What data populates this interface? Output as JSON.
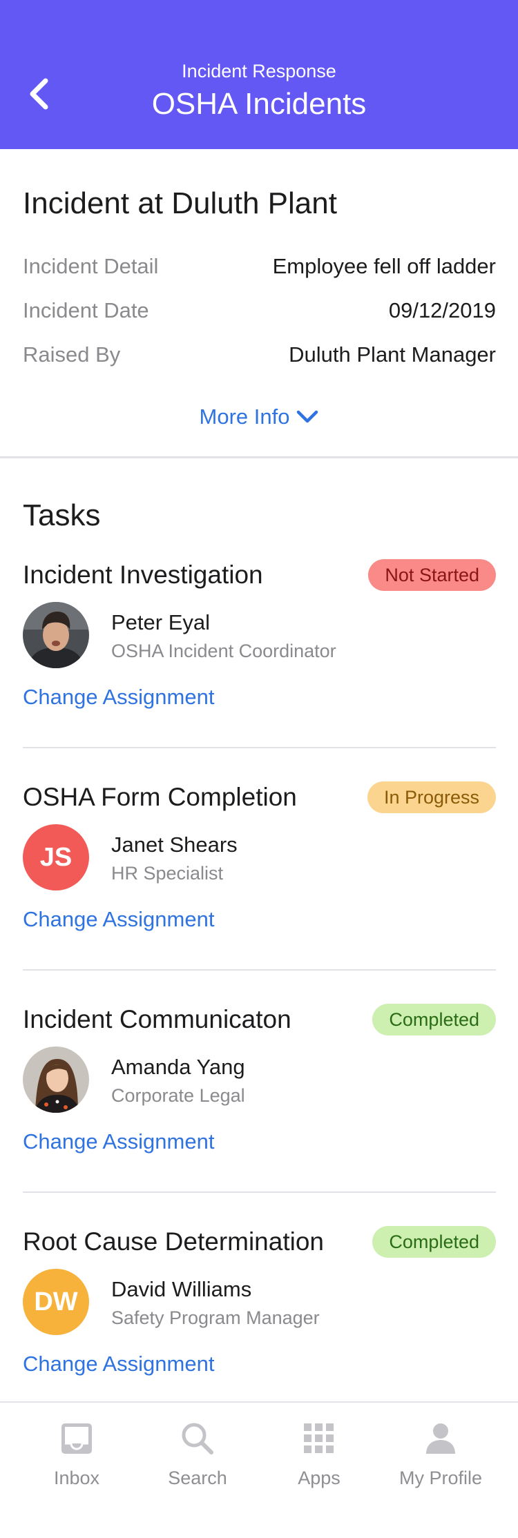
{
  "header": {
    "subtitle": "Incident Response",
    "title": "OSHA Incidents",
    "bg_color": "#6358f4"
  },
  "incident": {
    "title": "Incident at Duluth Plant",
    "details": [
      {
        "label": "Incident Detail",
        "value": "Employee fell off ladder"
      },
      {
        "label": "Incident Date",
        "value": "09/12/2019"
      },
      {
        "label": "Raised By",
        "value": "Duluth Plant Manager"
      }
    ],
    "more_info_label": "More Info",
    "more_info_icon": "chevron-down-icon"
  },
  "tasks": {
    "heading": "Tasks",
    "change_label": "Change Assignment",
    "items": [
      {
        "title": "Incident Investigation",
        "status": "Not Started",
        "status_color": "#f98a88",
        "assignee": "Peter Eyal",
        "role": "OSHA Incident Coordinator",
        "avatar": "photo"
      },
      {
        "title": "OSHA Form Completion",
        "status": "In Progress",
        "status_color": "#fbd58f",
        "assignee": "Janet Shears",
        "role": "HR Specialist",
        "avatar": "JS",
        "avatar_color": "#f25a57"
      },
      {
        "title": "Incident Communicaton",
        "status": "Completed",
        "status_color": "#cdf0b0",
        "assignee": "Amanda Yang",
        "role": "Corporate Legal",
        "avatar": "photo"
      },
      {
        "title": "Root Cause Determination",
        "status": "Completed",
        "status_color": "#cdf0b0",
        "assignee": "David Williams",
        "role": "Safety Program Manager",
        "avatar": "DW",
        "avatar_color": "#f7b23b"
      }
    ]
  },
  "tabbar": {
    "items": [
      {
        "label": "Inbox",
        "icon": "inbox-icon"
      },
      {
        "label": "Search",
        "icon": "search-icon"
      },
      {
        "label": "Apps",
        "icon": "apps-grid-icon"
      },
      {
        "label": "My Profile",
        "icon": "person-icon"
      }
    ]
  }
}
